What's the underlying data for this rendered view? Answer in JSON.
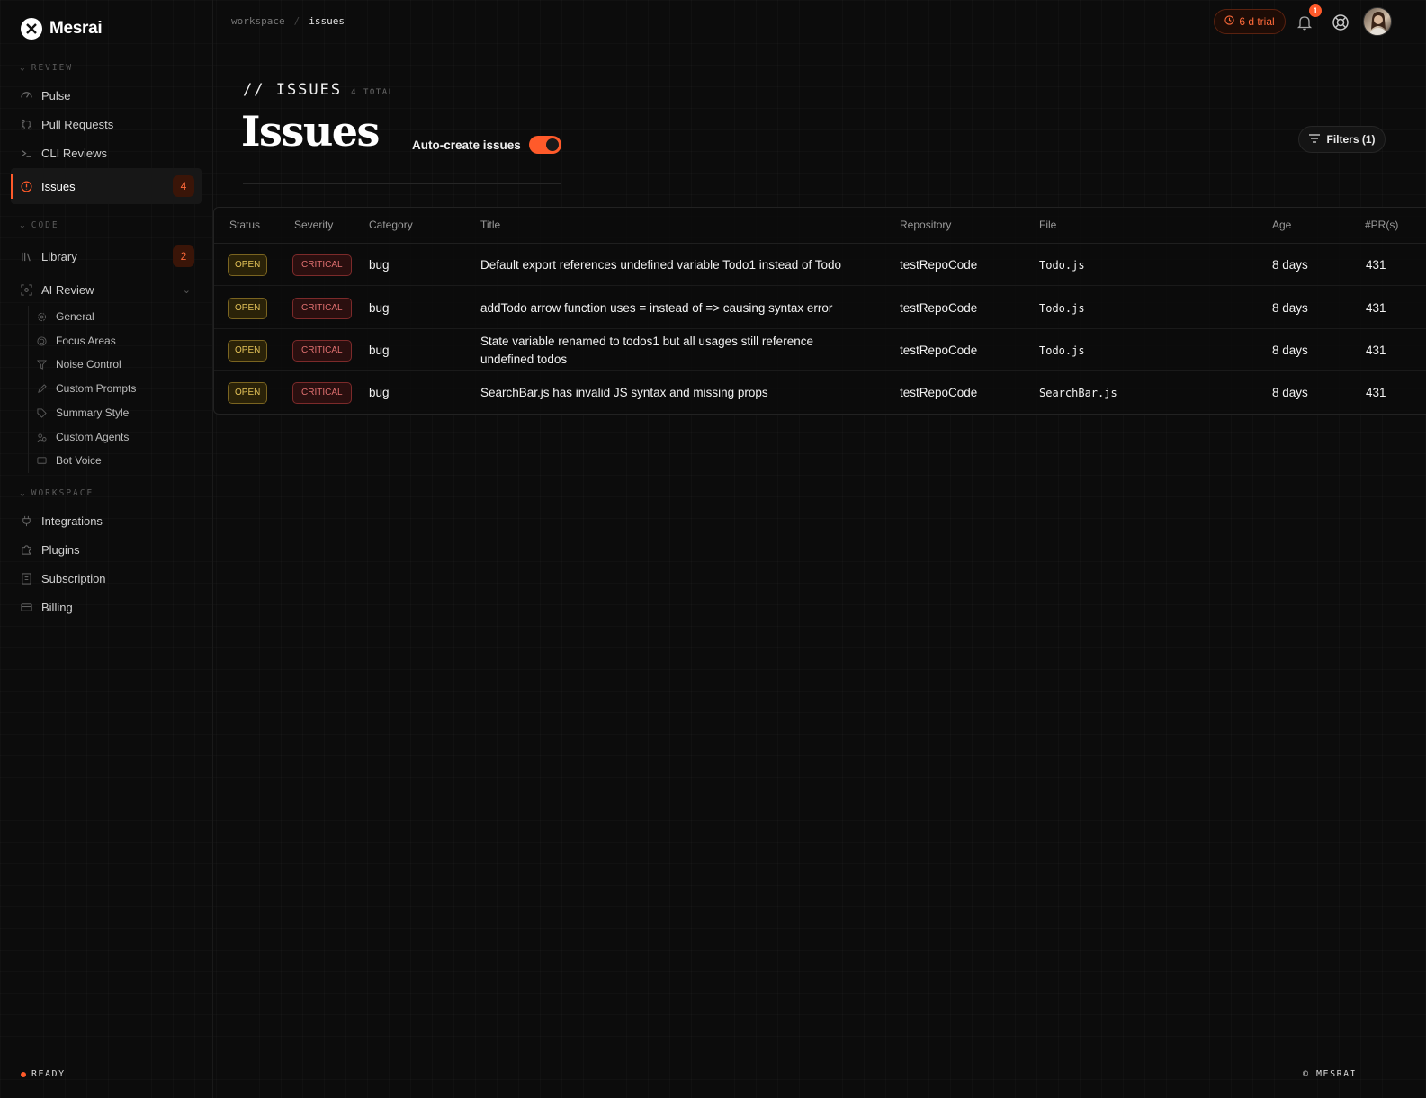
{
  "app": {
    "brand": "Mesrai",
    "status": "READY",
    "copyright": "© MESRAI"
  },
  "colors": {
    "accent": "#ff5a2a",
    "background": "#0c0c0c",
    "open_badge": "#e3c258",
    "critical_badge": "#e07070"
  },
  "breadcrumb": {
    "root": "workspace",
    "separator": "/",
    "current": "issues"
  },
  "topbar": {
    "trial_label": "6 d trial",
    "notification_count": "1"
  },
  "sidebar": {
    "sections": {
      "review": "REVIEW",
      "code": "CODE",
      "workspace": "WORKSPACE"
    },
    "review_items": [
      {
        "label": "Pulse",
        "icon": "pulse-icon"
      },
      {
        "label": "Pull Requests",
        "icon": "pull-request-icon"
      },
      {
        "label": "CLI Reviews",
        "icon": "terminal-icon"
      },
      {
        "label": "Issues",
        "icon": "alert-circle-icon",
        "count": "4",
        "active": true
      }
    ],
    "code_items": [
      {
        "label": "Library",
        "icon": "library-icon",
        "count": "2"
      },
      {
        "label": "AI Review",
        "icon": "ai-review-icon"
      }
    ],
    "ai_review_subitems": [
      {
        "label": "General",
        "icon": "gear-icon"
      },
      {
        "label": "Focus Areas",
        "icon": "target-icon"
      },
      {
        "label": "Noise Control",
        "icon": "filter-icon"
      },
      {
        "label": "Custom Prompts",
        "icon": "pen-icon"
      },
      {
        "label": "Summary Style",
        "icon": "tag-icon"
      },
      {
        "label": "Custom Agents",
        "icon": "agents-icon"
      },
      {
        "label": "Bot Voice",
        "icon": "message-icon"
      }
    ],
    "workspace_items": [
      {
        "label": "Integrations",
        "icon": "plug-icon"
      },
      {
        "label": "Plugins",
        "icon": "puzzle-icon"
      },
      {
        "label": "Subscription",
        "icon": "receipt-icon"
      },
      {
        "label": "Billing",
        "icon": "credit-card-icon"
      }
    ]
  },
  "header": {
    "kicker": "// ISSUES",
    "total": "4 TOTAL",
    "title": "Issues",
    "auto_create_label": "Auto-create issues",
    "auto_create_enabled": true,
    "filters_label": "Filters (1)"
  },
  "table": {
    "columns": [
      "Status",
      "Severity",
      "Category",
      "Title",
      "Repository",
      "File",
      "Age",
      "#PR(s)"
    ],
    "rows": [
      {
        "status": "OPEN",
        "severity": "CRITICAL",
        "category": "bug",
        "title": "Default export references undefined variable Todo1 instead of Todo",
        "repository": "testRepoCode",
        "file": "Todo.js",
        "age": "8 days",
        "prs": "431"
      },
      {
        "status": "OPEN",
        "severity": "CRITICAL",
        "category": "bug",
        "title": "addTodo arrow function uses = instead of => causing syntax error",
        "repository": "testRepoCode",
        "file": "Todo.js",
        "age": "8 days",
        "prs": "431"
      },
      {
        "status": "OPEN",
        "severity": "CRITICAL",
        "category": "bug",
        "title": "State variable renamed to todos1 but all usages still reference undefined todos",
        "repository": "testRepoCode",
        "file": "Todo.js",
        "age": "8 days",
        "prs": "431"
      },
      {
        "status": "OPEN",
        "severity": "CRITICAL",
        "category": "bug",
        "title": "SearchBar.js has invalid JS syntax and missing props",
        "repository": "testRepoCode",
        "file": "SearchBar.js",
        "age": "8 days",
        "prs": "431"
      }
    ]
  }
}
